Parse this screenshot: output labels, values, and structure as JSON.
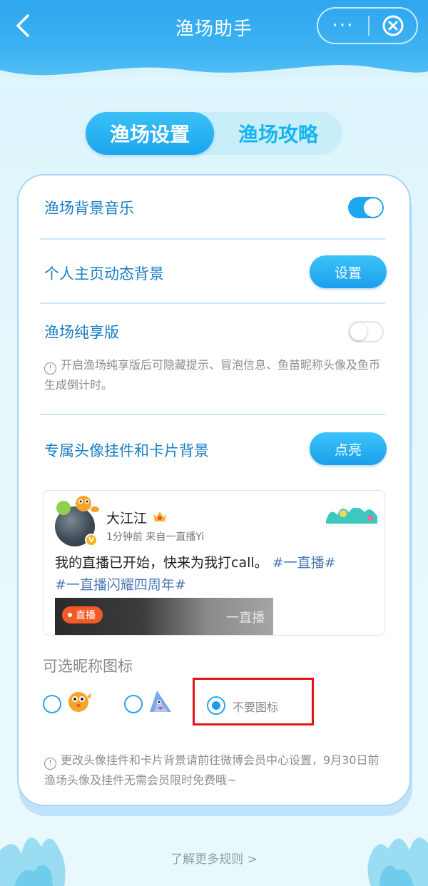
{
  "header": {
    "title": "渔场助手",
    "more_label": "···"
  },
  "tabs": [
    {
      "label": "渔场设置",
      "active": true
    },
    {
      "label": "渔场攻略",
      "active": false
    }
  ],
  "settings": {
    "bg_music": {
      "label": "渔场背景音乐",
      "enabled": true
    },
    "dynamic_bg": {
      "label": "个人主页动态背景",
      "button": "设置"
    },
    "pure_mode": {
      "label": "渔场纯享版",
      "enabled": false,
      "hint": "开启渔场纯享版后可隐藏提示、冒泡信息、鱼苗昵称头像及鱼币生成倒计时。"
    },
    "pendant": {
      "label": "专属头像挂件和卡片背景",
      "button": "点亮"
    }
  },
  "preview_card": {
    "username": "大江江",
    "meta": "1分钟前  来自一直播Yi",
    "post_text": "我的直播已开始，快来为我打call。",
    "tag1": "#一直播#",
    "tag2": "#一直播闪耀四周年#",
    "live_badge": "直播",
    "live_watermark": "一直播"
  },
  "nickname_icons": {
    "title": "可选昵称图标",
    "options": [
      {
        "icon": "pufferfish-icon",
        "selected": false
      },
      {
        "icon": "shark-icon",
        "selected": false
      },
      {
        "label": "不要图标",
        "selected": true
      }
    ],
    "hint": "更改头像挂件和卡片背景请前往微博会员中心设置，9月30日前渔场头像及挂件无需会员限时免费哦~"
  },
  "footer": {
    "link": "了解更多规则 >"
  },
  "colors": {
    "primary": "#1ea6ef",
    "label_blue": "#1a7fc4",
    "highlight_red": "#e3151b"
  }
}
